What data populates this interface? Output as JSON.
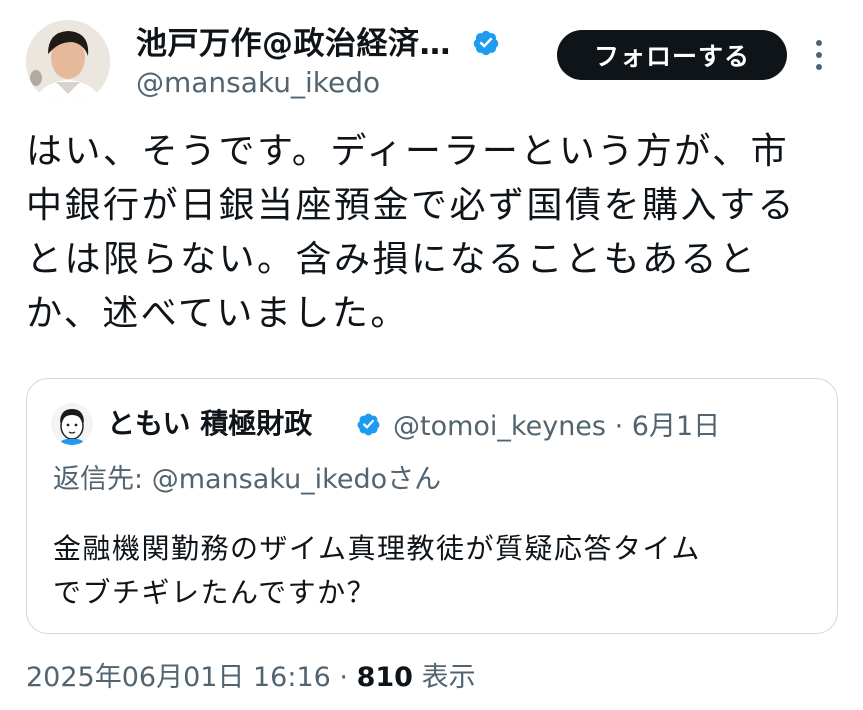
{
  "author": {
    "display_name": "池戸万作@政治経済…",
    "handle": "@mansaku_ikedo",
    "verified": true
  },
  "follow_button": {
    "label": "フォローする"
  },
  "more_icon": "more-vertical-icon",
  "tweet": {
    "lines": [
      "はい、そうです。ディーラーという方が、市",
      "中銀行が日銀当座預金で必ず国債を購入する",
      "とは限らない。含み損になることもあると",
      "か、述べていました。"
    ]
  },
  "quote": {
    "author_name": "ともい 積極財政",
    "author_handle": "@tomoi_keynes",
    "separator": "·",
    "date": "6月1日",
    "reply_prefix": "返信先: ",
    "reply_mention": "@mansaku_ikedo",
    "reply_suffix": "さん",
    "lines": [
      "金融機関勤務のザイム真理教徒が質疑応答タイム",
      "でブチギレたんですか？"
    ]
  },
  "footer": {
    "timestamp": "2025年06月01日 16:16",
    "separator": "·",
    "views_count": "810",
    "views_label": "表示"
  },
  "colors": {
    "verified": "#1d9bf0",
    "follow_bg": "#0f1419",
    "secondary_text": "#536471",
    "border": "#cfd9de"
  }
}
